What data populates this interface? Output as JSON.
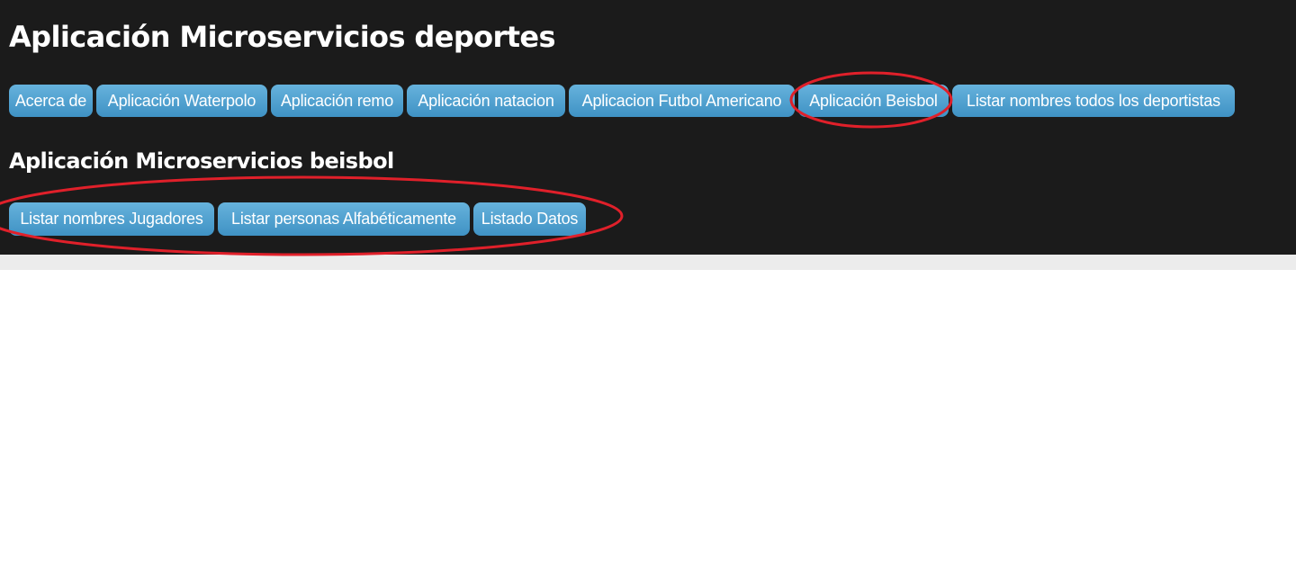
{
  "header": {
    "title": "Aplicación Microservicios deportes",
    "nav": [
      "Acerca de",
      "Aplicación Waterpolo",
      "Aplicación remo",
      "Aplicación natacion",
      "Aplicacion Futbol Americano",
      "Aplicación Beisbol",
      "Listar nombres todos los deportistas"
    ]
  },
  "section": {
    "title": "Aplicación Microservicios beisbol",
    "actions": [
      "Listar nombres Jugadores",
      "Listar personas Alfabéticamente",
      "Listado Datos"
    ]
  },
  "colors": {
    "header_bg": "#1b1b1b",
    "button_top": "#66b2dc",
    "button_bottom": "#3f92c4",
    "annotation": "#e0202a"
  }
}
